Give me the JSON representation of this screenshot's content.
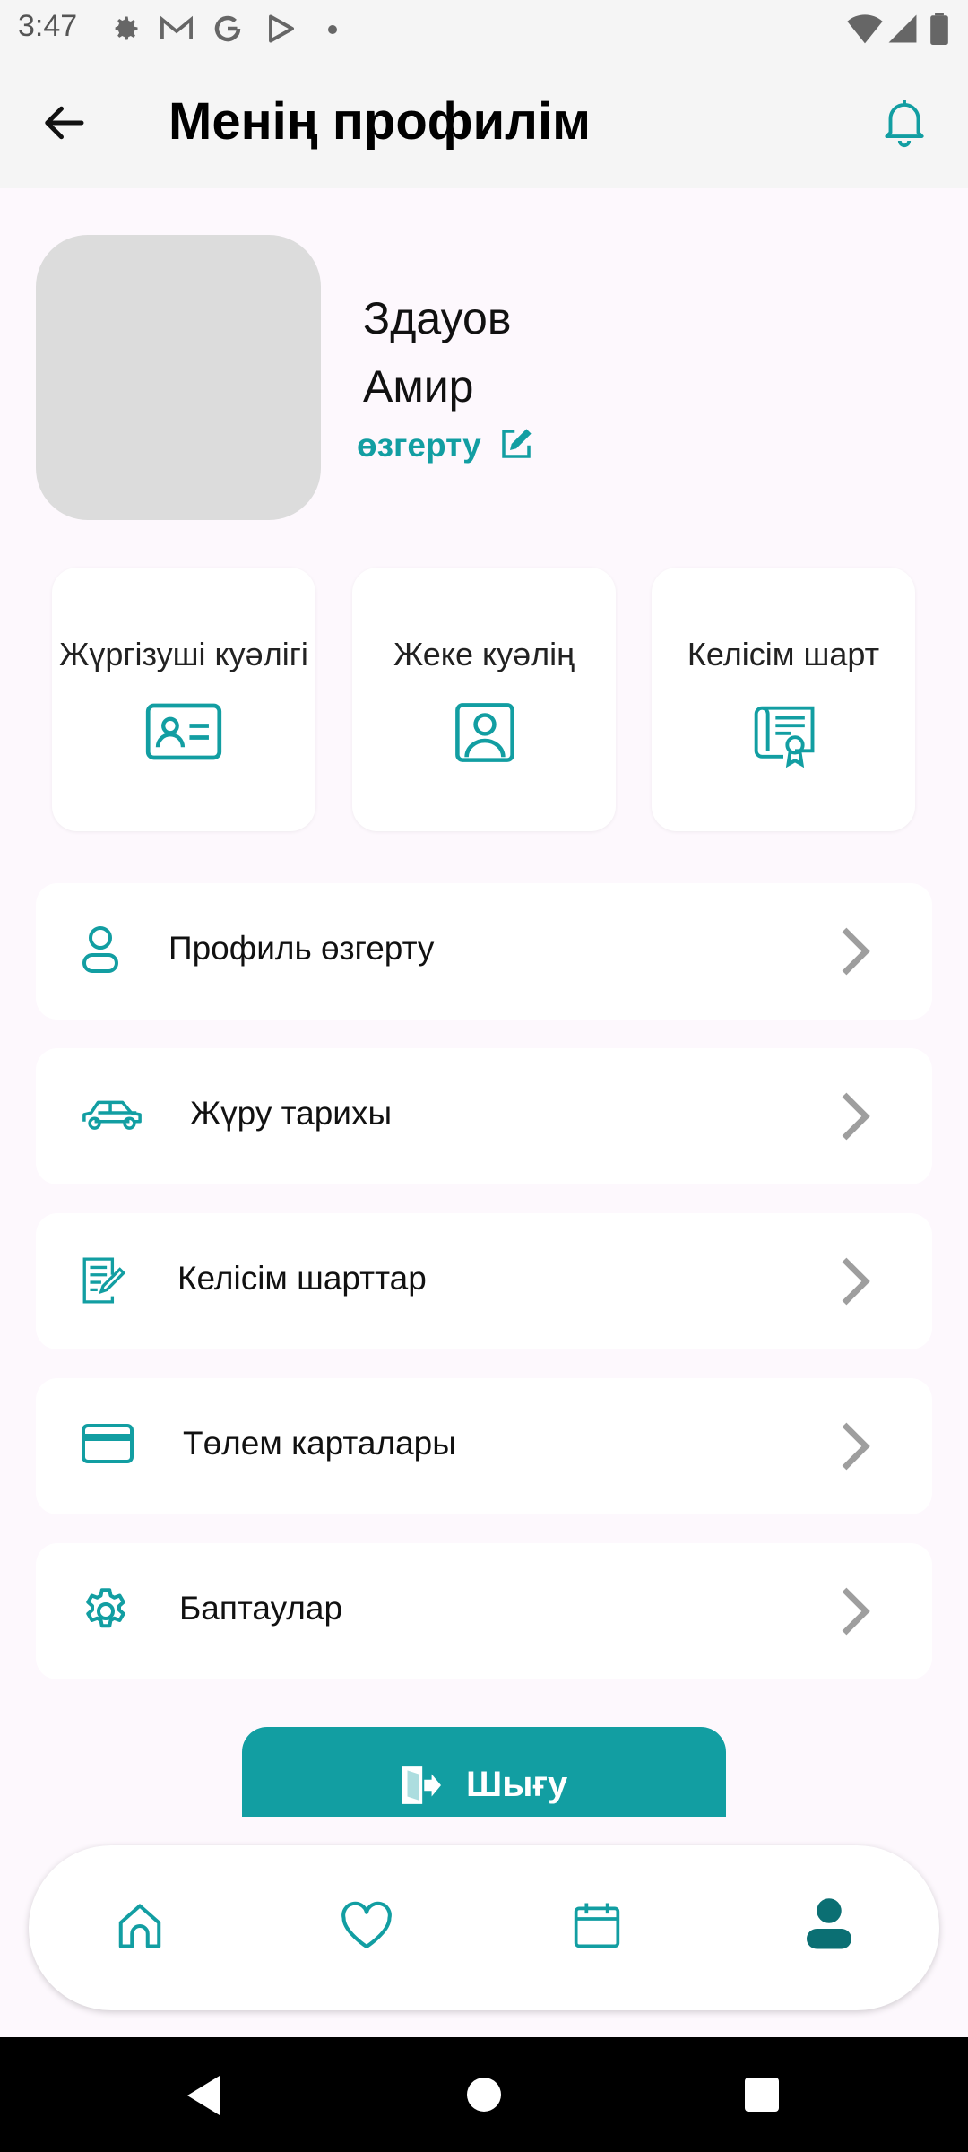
{
  "status_bar": {
    "time": "3:47"
  },
  "header": {
    "title": "Менің профилім"
  },
  "profile": {
    "first_line": "Здауов",
    "second_line": "Амир",
    "edit_label": "өзгерту"
  },
  "documents": [
    {
      "label": "Жүргізуші куәлігі",
      "icon": "id-card-icon"
    },
    {
      "label": "Жеке куәлің",
      "icon": "person-id-icon"
    },
    {
      "label": "Келісім шарт",
      "icon": "certificate-icon"
    }
  ],
  "menu": [
    {
      "label": "Профиль өзгерту",
      "icon": "user-icon"
    },
    {
      "label": "Жүру тарихы",
      "icon": "car-icon"
    },
    {
      "label": "Келісім шарттар",
      "icon": "contract-icon"
    },
    {
      "label": "Төлем карталары",
      "icon": "credit-card-icon"
    },
    {
      "label": "Баптаулар",
      "icon": "settings-icon"
    }
  ],
  "logout": {
    "label": "Шығу"
  },
  "bottom_nav": [
    {
      "icon": "home-icon",
      "active": false
    },
    {
      "icon": "heart-icon",
      "active": false
    },
    {
      "icon": "calendar-icon",
      "active": false
    },
    {
      "icon": "profile-icon",
      "active": true
    }
  ],
  "colors": {
    "accent": "#129ea2",
    "background": "#fdf8fd",
    "chevron": "#9e9e9e"
  }
}
